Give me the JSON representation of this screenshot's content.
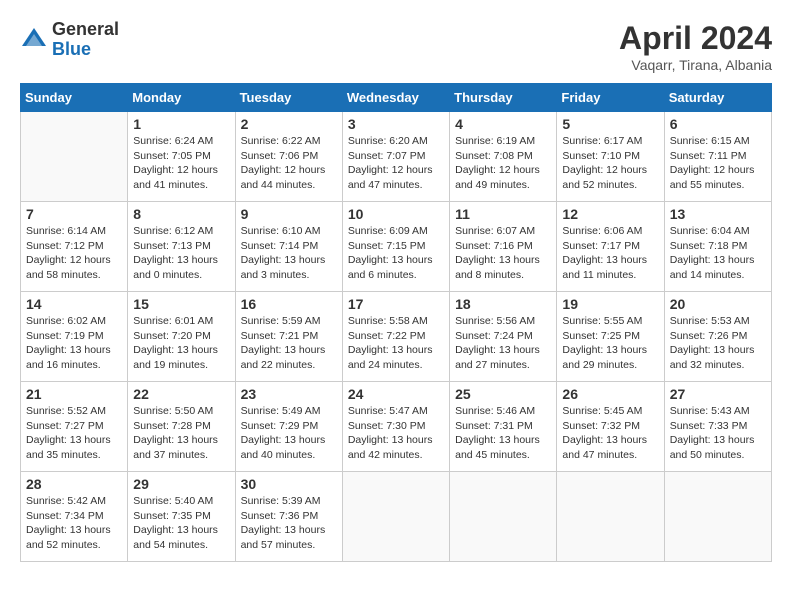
{
  "header": {
    "logo_general": "General",
    "logo_blue": "Blue",
    "month_title": "April 2024",
    "subtitle": "Vaqarr, Tirana, Albania"
  },
  "weekdays": [
    "Sunday",
    "Monday",
    "Tuesday",
    "Wednesday",
    "Thursday",
    "Friday",
    "Saturday"
  ],
  "weeks": [
    [
      {
        "day": "",
        "info": ""
      },
      {
        "day": "1",
        "info": "Sunrise: 6:24 AM\nSunset: 7:05 PM\nDaylight: 12 hours\nand 41 minutes."
      },
      {
        "day": "2",
        "info": "Sunrise: 6:22 AM\nSunset: 7:06 PM\nDaylight: 12 hours\nand 44 minutes."
      },
      {
        "day": "3",
        "info": "Sunrise: 6:20 AM\nSunset: 7:07 PM\nDaylight: 12 hours\nand 47 minutes."
      },
      {
        "day": "4",
        "info": "Sunrise: 6:19 AM\nSunset: 7:08 PM\nDaylight: 12 hours\nand 49 minutes."
      },
      {
        "day": "5",
        "info": "Sunrise: 6:17 AM\nSunset: 7:10 PM\nDaylight: 12 hours\nand 52 minutes."
      },
      {
        "day": "6",
        "info": "Sunrise: 6:15 AM\nSunset: 7:11 PM\nDaylight: 12 hours\nand 55 minutes."
      }
    ],
    [
      {
        "day": "7",
        "info": "Sunrise: 6:14 AM\nSunset: 7:12 PM\nDaylight: 12 hours\nand 58 minutes."
      },
      {
        "day": "8",
        "info": "Sunrise: 6:12 AM\nSunset: 7:13 PM\nDaylight: 13 hours\nand 0 minutes."
      },
      {
        "day": "9",
        "info": "Sunrise: 6:10 AM\nSunset: 7:14 PM\nDaylight: 13 hours\nand 3 minutes."
      },
      {
        "day": "10",
        "info": "Sunrise: 6:09 AM\nSunset: 7:15 PM\nDaylight: 13 hours\nand 6 minutes."
      },
      {
        "day": "11",
        "info": "Sunrise: 6:07 AM\nSunset: 7:16 PM\nDaylight: 13 hours\nand 8 minutes."
      },
      {
        "day": "12",
        "info": "Sunrise: 6:06 AM\nSunset: 7:17 PM\nDaylight: 13 hours\nand 11 minutes."
      },
      {
        "day": "13",
        "info": "Sunrise: 6:04 AM\nSunset: 7:18 PM\nDaylight: 13 hours\nand 14 minutes."
      }
    ],
    [
      {
        "day": "14",
        "info": "Sunrise: 6:02 AM\nSunset: 7:19 PM\nDaylight: 13 hours\nand 16 minutes."
      },
      {
        "day": "15",
        "info": "Sunrise: 6:01 AM\nSunset: 7:20 PM\nDaylight: 13 hours\nand 19 minutes."
      },
      {
        "day": "16",
        "info": "Sunrise: 5:59 AM\nSunset: 7:21 PM\nDaylight: 13 hours\nand 22 minutes."
      },
      {
        "day": "17",
        "info": "Sunrise: 5:58 AM\nSunset: 7:22 PM\nDaylight: 13 hours\nand 24 minutes."
      },
      {
        "day": "18",
        "info": "Sunrise: 5:56 AM\nSunset: 7:24 PM\nDaylight: 13 hours\nand 27 minutes."
      },
      {
        "day": "19",
        "info": "Sunrise: 5:55 AM\nSunset: 7:25 PM\nDaylight: 13 hours\nand 29 minutes."
      },
      {
        "day": "20",
        "info": "Sunrise: 5:53 AM\nSunset: 7:26 PM\nDaylight: 13 hours\nand 32 minutes."
      }
    ],
    [
      {
        "day": "21",
        "info": "Sunrise: 5:52 AM\nSunset: 7:27 PM\nDaylight: 13 hours\nand 35 minutes."
      },
      {
        "day": "22",
        "info": "Sunrise: 5:50 AM\nSunset: 7:28 PM\nDaylight: 13 hours\nand 37 minutes."
      },
      {
        "day": "23",
        "info": "Sunrise: 5:49 AM\nSunset: 7:29 PM\nDaylight: 13 hours\nand 40 minutes."
      },
      {
        "day": "24",
        "info": "Sunrise: 5:47 AM\nSunset: 7:30 PM\nDaylight: 13 hours\nand 42 minutes."
      },
      {
        "day": "25",
        "info": "Sunrise: 5:46 AM\nSunset: 7:31 PM\nDaylight: 13 hours\nand 45 minutes."
      },
      {
        "day": "26",
        "info": "Sunrise: 5:45 AM\nSunset: 7:32 PM\nDaylight: 13 hours\nand 47 minutes."
      },
      {
        "day": "27",
        "info": "Sunrise: 5:43 AM\nSunset: 7:33 PM\nDaylight: 13 hours\nand 50 minutes."
      }
    ],
    [
      {
        "day": "28",
        "info": "Sunrise: 5:42 AM\nSunset: 7:34 PM\nDaylight: 13 hours\nand 52 minutes."
      },
      {
        "day": "29",
        "info": "Sunrise: 5:40 AM\nSunset: 7:35 PM\nDaylight: 13 hours\nand 54 minutes."
      },
      {
        "day": "30",
        "info": "Sunrise: 5:39 AM\nSunset: 7:36 PM\nDaylight: 13 hours\nand 57 minutes."
      },
      {
        "day": "",
        "info": ""
      },
      {
        "day": "",
        "info": ""
      },
      {
        "day": "",
        "info": ""
      },
      {
        "day": "",
        "info": ""
      }
    ]
  ]
}
